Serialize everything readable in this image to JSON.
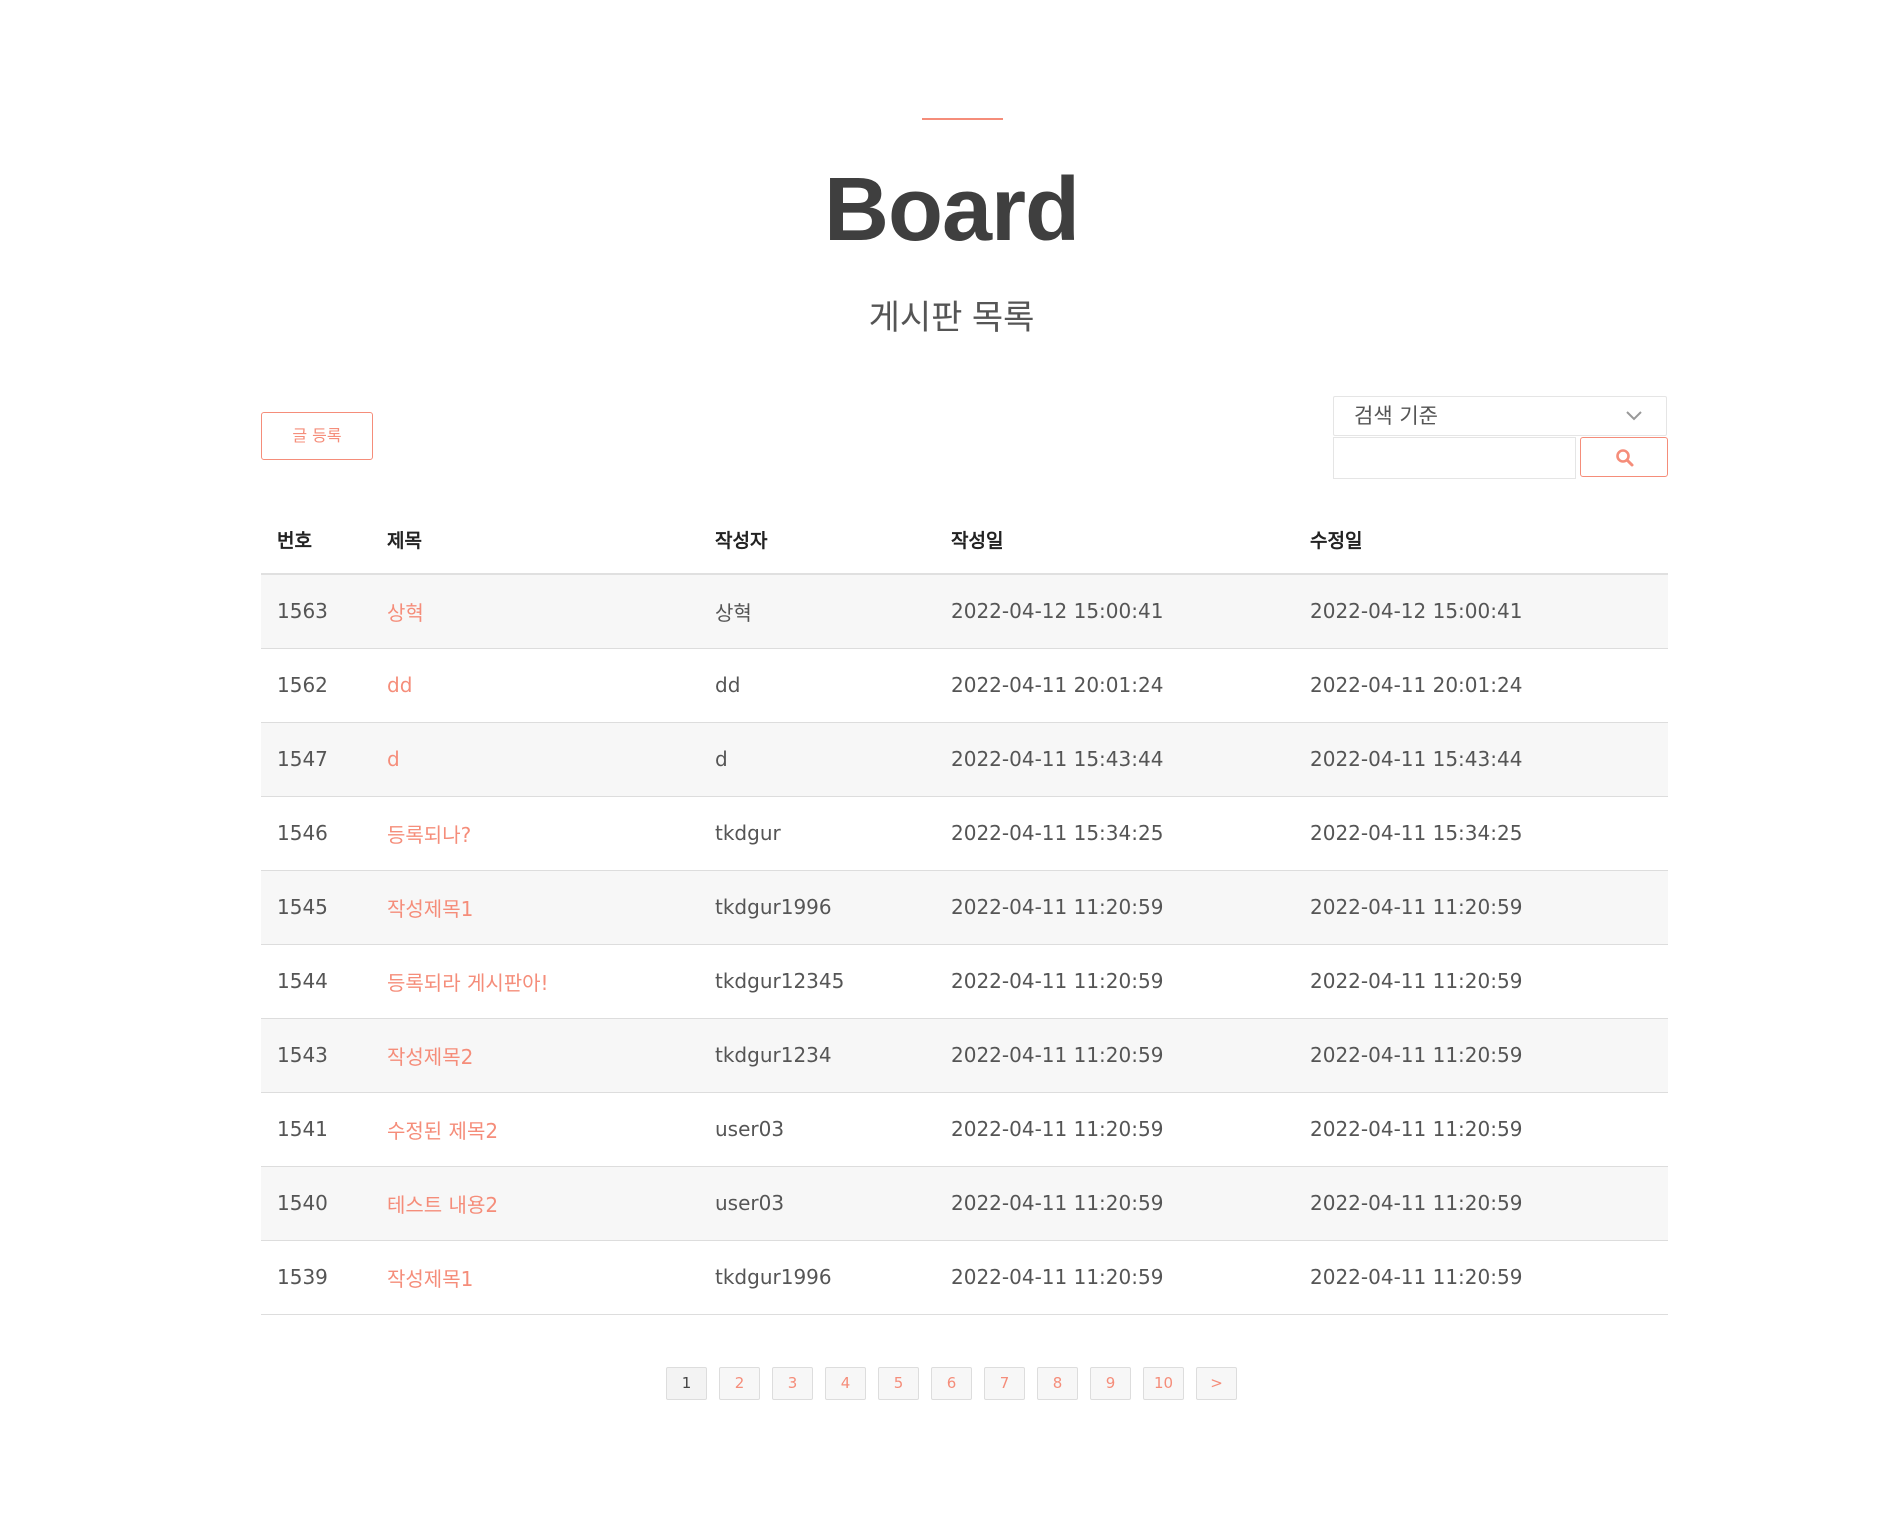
{
  "header": {
    "title": "Board",
    "subtitle": "게시판 목록"
  },
  "toolbar": {
    "write_label": "글 등록",
    "search_select_label": "검색 기준",
    "search_input_value": ""
  },
  "table": {
    "columns": [
      "번호",
      "제목",
      "작성자",
      "작성일",
      "수정일"
    ],
    "rows": [
      {
        "num": "1563",
        "title": "상혁",
        "writer": "상혁",
        "created": "2022-04-12 15:00:41",
        "updated": "2022-04-12 15:00:41"
      },
      {
        "num": "1562",
        "title": "dd",
        "writer": "dd",
        "created": "2022-04-11 20:01:24",
        "updated": "2022-04-11 20:01:24"
      },
      {
        "num": "1547",
        "title": "d",
        "writer": "d",
        "created": "2022-04-11 15:43:44",
        "updated": "2022-04-11 15:43:44"
      },
      {
        "num": "1546",
        "title": "등록되나?",
        "writer": "tkdgur",
        "created": "2022-04-11 15:34:25",
        "updated": "2022-04-11 15:34:25"
      },
      {
        "num": "1545",
        "title": "작성제목1",
        "writer": "tkdgur1996",
        "created": "2022-04-11 11:20:59",
        "updated": "2022-04-11 11:20:59"
      },
      {
        "num": "1544",
        "title": "등록되라 게시판아!",
        "writer": "tkdgur12345",
        "created": "2022-04-11 11:20:59",
        "updated": "2022-04-11 11:20:59"
      },
      {
        "num": "1543",
        "title": "작성제목2",
        "writer": "tkdgur1234",
        "created": "2022-04-11 11:20:59",
        "updated": "2022-04-11 11:20:59"
      },
      {
        "num": "1541",
        "title": "수정된 제목2",
        "writer": "user03",
        "created": "2022-04-11 11:20:59",
        "updated": "2022-04-11 11:20:59"
      },
      {
        "num": "1540",
        "title": "테스트 내용2",
        "writer": "user03",
        "created": "2022-04-11 11:20:59",
        "updated": "2022-04-11 11:20:59"
      },
      {
        "num": "1539",
        "title": "작성제목1",
        "writer": "tkdgur1996",
        "created": "2022-04-11 11:20:59",
        "updated": "2022-04-11 11:20:59"
      }
    ]
  },
  "pagination": {
    "pages": [
      "1",
      "2",
      "3",
      "4",
      "5",
      "6",
      "7",
      "8",
      "9",
      "10"
    ],
    "current": "1",
    "next_label": ">"
  },
  "colors": {
    "accent": "#f58d7a",
    "title": "#3f3f3f",
    "row_alt": "#f7f7f7"
  },
  "icons": {
    "search": "search-icon",
    "select": "chevron-down-icon"
  }
}
